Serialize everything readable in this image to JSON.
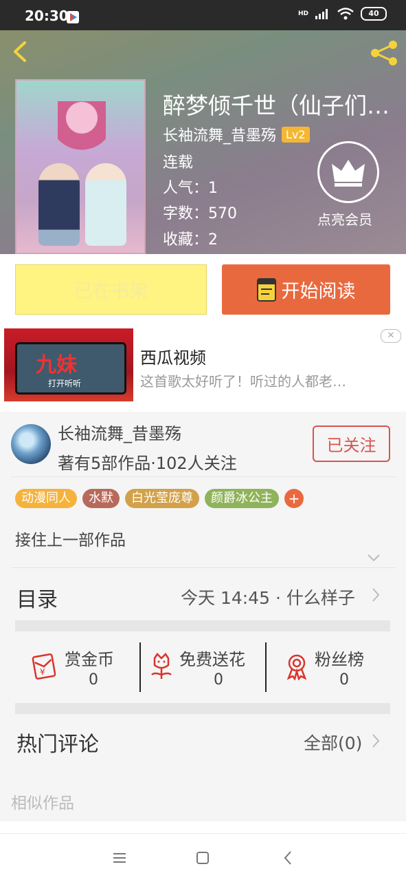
{
  "status_bar": {
    "time": "20:30",
    "network": "HD",
    "battery": "40"
  },
  "book": {
    "title": "醉梦倾千世（仙子们…",
    "author": "长袖流舞_昔墨殇",
    "author_level": "Lv2",
    "status": "连载",
    "popularity": "人气：1",
    "word_count": "字数：570",
    "favorites": "收藏：2",
    "vip_label": "点亮会员"
  },
  "actions": {
    "shelf_label": "已在书架",
    "read_label": "开始阅读"
  },
  "ad": {
    "title": "西瓜视频",
    "description": "这首歌太好听了！听过的人都老…",
    "image_text": "九妹",
    "image_sub": "打开听听",
    "close": "✕"
  },
  "author_card": {
    "name": "长袖流舞_昔墨殇",
    "stats": "著有5部作品·102人关注",
    "follow_label": "已关注"
  },
  "tags": [
    {
      "label": "动漫同人",
      "color": "#f5b23c"
    },
    {
      "label": "水默",
      "color": "#b86a5a"
    },
    {
      "label": "白光莹庞尊",
      "color": "#d2a14a"
    },
    {
      "label": "颜爵冰公主",
      "color": "#8fb35a"
    }
  ],
  "tag_add": "+",
  "intro": "接住上一部作品",
  "toc": {
    "label": "目录",
    "latest": "今天 14:45 · 什么样子"
  },
  "rewards": [
    {
      "label": "赏金币",
      "value": "0",
      "icon": "red-envelope-icon"
    },
    {
      "label": "免费送花",
      "value": "0",
      "icon": "flower-icon"
    },
    {
      "label": "粉丝榜",
      "value": "0",
      "icon": "medal-icon"
    }
  ],
  "comments": {
    "label": "热门评论",
    "all": "全部(0)"
  },
  "similar": {
    "label": "相似作品"
  },
  "colors": {
    "accent": "#e9693f",
    "shelf_bg": "#fff382",
    "follow": "#d9534f",
    "icon_red": "#d9342b"
  }
}
